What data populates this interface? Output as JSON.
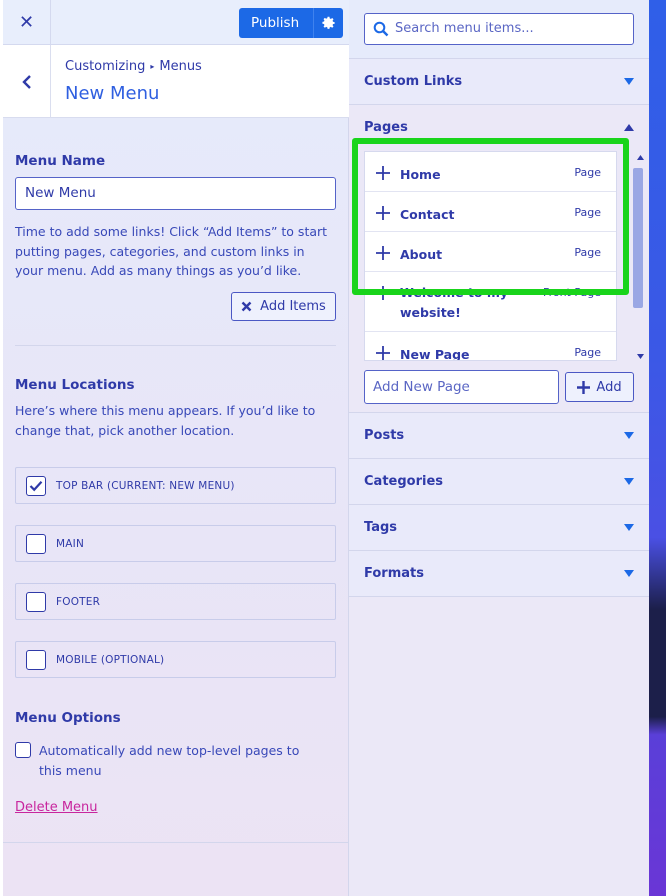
{
  "topbar": {
    "close_label": "✕",
    "publish_label": "Publish"
  },
  "header": {
    "breadcrumb_root": "Customizing",
    "breadcrumb_child": "Menus",
    "title": "New Menu"
  },
  "menu_name": {
    "label": "Menu Name",
    "value": "New Menu",
    "help": "Time to add some links! Click “Add Items” to start putting pages, categories, and custom links in your menu. Add as many things as you’d like.",
    "add_items_label": "Add Items"
  },
  "locations": {
    "label": "Menu Locations",
    "help": "Here’s where this menu appears. If you’d like to change that, pick another location.",
    "items": [
      {
        "label": "TOP BAR (CURRENT: NEW MENU)",
        "checked": true
      },
      {
        "label": "MAIN",
        "checked": false
      },
      {
        "label": "FOOTER",
        "checked": false
      },
      {
        "label": "MOBILE (OPTIONAL)",
        "checked": false
      }
    ]
  },
  "options": {
    "label": "Menu Options",
    "auto_add_label": "Automatically add new top-level pages to this menu",
    "delete_label": "Delete Menu"
  },
  "search": {
    "placeholder": "Search menu items..."
  },
  "sections": {
    "custom_links": "Custom Links",
    "pages": "Pages",
    "posts": "Posts",
    "categories": "Categories",
    "tags": "Tags",
    "formats": "Formats"
  },
  "pages": [
    {
      "name": "Home",
      "type": "Page"
    },
    {
      "name": "Contact",
      "type": "Page"
    },
    {
      "name": "About",
      "type": "Page"
    },
    {
      "name": "Welcome to my website!",
      "type": "Front Page"
    },
    {
      "name": "New Page",
      "type": "Page"
    }
  ],
  "add_page": {
    "placeholder": "Add New Page",
    "button_label": "Add"
  },
  "colors": {
    "accent": "#1c69e6",
    "text": "#2f3aa8",
    "delete": "#c8269e",
    "highlight": "#19d41b"
  }
}
